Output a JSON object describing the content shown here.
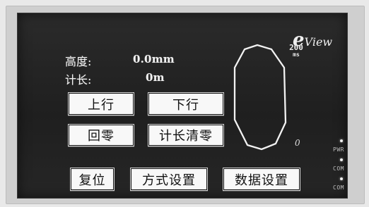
{
  "brand": {
    "symbol": "e",
    "name": "View"
  },
  "readout": {
    "top_value": "200",
    "top_unit": "ms"
  },
  "fields": {
    "height": {
      "label": "高度:",
      "value": "0.0mm"
    },
    "length": {
      "label": "计长:",
      "value": "0m"
    }
  },
  "buttons": {
    "up": "上行",
    "down": "下行",
    "home": "回零",
    "length_reset": "计长清零",
    "reset": "复位",
    "mode_settings": "方式设置",
    "data_settings": "数据设置"
  },
  "indicator": {
    "zero_mark": "0"
  },
  "side_labels": {
    "pwr": "PWR",
    "com1": "COM",
    "com2": "COM"
  }
}
